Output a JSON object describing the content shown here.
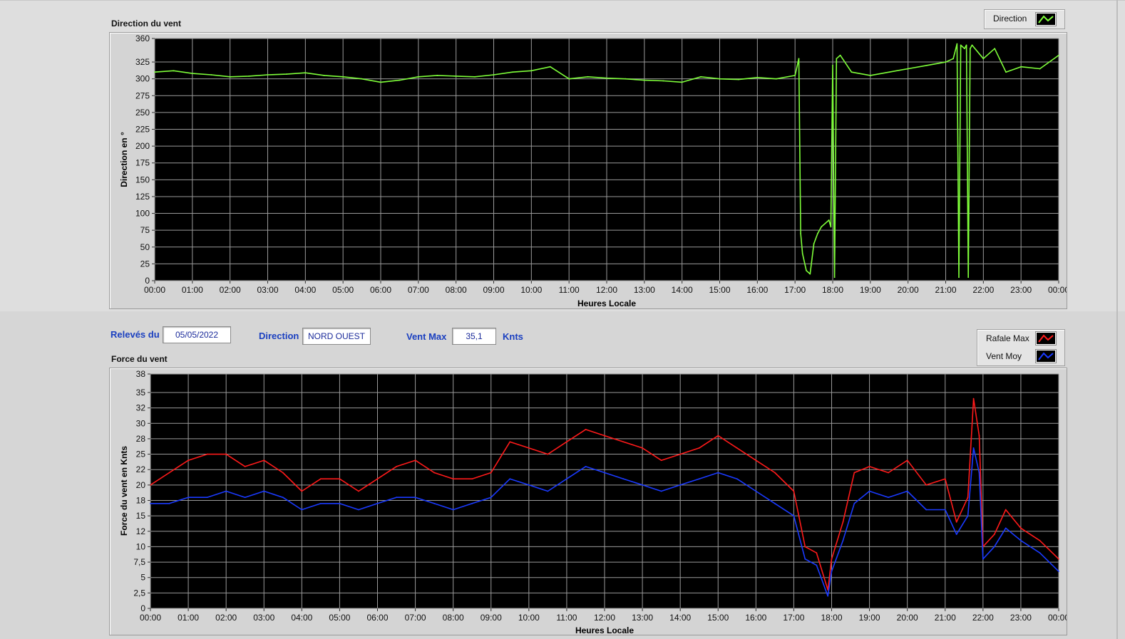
{
  "direction_chart": {
    "title": "Direction du vent",
    "legend": [
      {
        "label": "Direction",
        "color": "#7fff3a"
      }
    ]
  },
  "controls": {
    "releves_label": "Relevés du",
    "releves_value": "05/05/2022",
    "direction_label": "Direction",
    "direction_value": "NORD OUEST",
    "ventmax_label": "Vent Max",
    "ventmax_value": "35,1",
    "ventmax_unit": "Knts"
  },
  "force_chart": {
    "title": "Force du vent",
    "legend": [
      {
        "label": "Rafale Max",
        "color": "#ff1a1a"
      },
      {
        "label": "Vent Moy",
        "color": "#1a3aff"
      }
    ]
  },
  "chart_data": [
    {
      "type": "line",
      "title": "Direction du vent",
      "xlabel": "Heures Locale",
      "ylabel": "Direction en °",
      "xlim": [
        0,
        24
      ],
      "ylim": [
        0,
        360
      ],
      "x_ticks": [
        "00:00",
        "01:00",
        "02:00",
        "03:00",
        "04:00",
        "05:00",
        "06:00",
        "07:00",
        "08:00",
        "09:00",
        "10:00",
        "11:00",
        "12:00",
        "13:00",
        "14:00",
        "15:00",
        "16:00",
        "17:00",
        "18:00",
        "19:00",
        "20:00",
        "21:00",
        "22:00",
        "23:00",
        "00:00"
      ],
      "y_ticks": [
        0,
        25,
        50,
        75,
        100,
        125,
        150,
        175,
        200,
        225,
        250,
        275,
        300,
        325,
        360
      ],
      "y_tick_labels": [
        "0",
        "25",
        "50",
        "75",
        "100",
        "125",
        "150",
        "175",
        "200",
        "225",
        "250",
        "275",
        "300",
        "325",
        "360"
      ],
      "grid": true,
      "legend_position": "top-right",
      "series": [
        {
          "name": "Direction",
          "color": "#7fff3a",
          "x": [
            0,
            0.5,
            1,
            1.5,
            2,
            2.5,
            3,
            3.5,
            4,
            4.5,
            5,
            5.5,
            6,
            6.5,
            7,
            7.5,
            8,
            8.5,
            9,
            9.5,
            10,
            10.5,
            11,
            11.5,
            12,
            12.5,
            13,
            13.5,
            14,
            14.5,
            15,
            15.5,
            16,
            16.5,
            17,
            17.1,
            17.15,
            17.2,
            17.3,
            17.4,
            17.5,
            17.6,
            17.7,
            17.8,
            17.9,
            17.95,
            18,
            18.05,
            18.1,
            18.2,
            18.5,
            19,
            19.5,
            20,
            20.5,
            21,
            21.2,
            21.3,
            21.35,
            21.4,
            21.5,
            21.55,
            21.6,
            21.65,
            21.7,
            22,
            22.3,
            22.6,
            23,
            23.5,
            24
          ],
          "y": [
            310,
            312,
            308,
            306,
            303,
            304,
            306,
            307,
            309,
            305,
            303,
            300,
            295,
            298,
            303,
            305,
            304,
            303,
            306,
            310,
            312,
            318,
            300,
            303,
            301,
            300,
            298,
            297,
            295,
            303,
            300,
            299,
            302,
            300,
            305,
            330,
            70,
            40,
            15,
            10,
            55,
            70,
            80,
            85,
            90,
            80,
            320,
            5,
            330,
            335,
            310,
            305,
            310,
            315,
            320,
            325,
            330,
            352,
            5,
            350,
            345,
            350,
            5,
            345,
            350,
            330,
            345,
            310,
            318,
            315,
            335
          ]
        }
      ]
    },
    {
      "type": "line",
      "title": "Force du vent",
      "xlabel": "Heures Locale",
      "ylabel": "Force du vent en Knts",
      "xlim": [
        0,
        24
      ],
      "ylim": [
        0,
        38
      ],
      "x_ticks": [
        "00:00",
        "01:00",
        "02:00",
        "03:00",
        "04:00",
        "05:00",
        "06:00",
        "07:00",
        "08:00",
        "09:00",
        "10:00",
        "11:00",
        "12:00",
        "13:00",
        "14:00",
        "15:00",
        "16:00",
        "17:00",
        "18:00",
        "19:00",
        "20:00",
        "21:00",
        "22:00",
        "23:00",
        "00:00"
      ],
      "y_ticks": [
        0,
        2.5,
        5,
        7.5,
        10,
        12.5,
        15,
        17.5,
        20,
        22.5,
        25,
        27.5,
        30,
        32.5,
        35,
        38
      ],
      "y_tick_labels": [
        "0",
        "2,5",
        "5",
        "7,5",
        "10",
        "12",
        "15",
        "18",
        "20",
        "22",
        "25",
        "28",
        "30",
        "32",
        "35",
        "38"
      ],
      "grid": true,
      "legend_position": "top-right",
      "series": [
        {
          "name": "Rafale Max",
          "color": "#ff1a1a",
          "x": [
            0,
            0.5,
            1,
            1.5,
            2,
            2.5,
            3,
            3.5,
            4,
            4.5,
            5,
            5.5,
            6,
            6.5,
            7,
            7.5,
            8,
            8.5,
            9,
            9.5,
            10,
            10.5,
            11,
            11.5,
            12,
            12.5,
            13,
            13.5,
            14,
            14.5,
            15,
            15.5,
            16,
            16.5,
            17,
            17.3,
            17.6,
            17.9,
            18,
            18.3,
            18.6,
            19,
            19.5,
            20,
            20.5,
            21,
            21.3,
            21.6,
            21.75,
            21.9,
            22,
            22.3,
            22.6,
            23,
            23.5,
            24
          ],
          "y": [
            20,
            22,
            24,
            25,
            25,
            23,
            24,
            22,
            19,
            21,
            21,
            19,
            21,
            23,
            24,
            22,
            21,
            21,
            22,
            27,
            26,
            25,
            27,
            29,
            28,
            27,
            26,
            24,
            25,
            26,
            28,
            26,
            24,
            22,
            19,
            10,
            9,
            3,
            8,
            14,
            22,
            23,
            22,
            24,
            20,
            21,
            14,
            18,
            34,
            28,
            10,
            12,
            16,
            13,
            11,
            8
          ]
        },
        {
          "name": "Vent Moy",
          "color": "#1a3aff",
          "x": [
            0,
            0.5,
            1,
            1.5,
            2,
            2.5,
            3,
            3.5,
            4,
            4.5,
            5,
            5.5,
            6,
            6.5,
            7,
            7.5,
            8,
            8.5,
            9,
            9.5,
            10,
            10.5,
            11,
            11.5,
            12,
            12.5,
            13,
            13.5,
            14,
            14.5,
            15,
            15.5,
            16,
            16.5,
            17,
            17.3,
            17.6,
            17.9,
            18,
            18.3,
            18.6,
            19,
            19.5,
            20,
            20.5,
            21,
            21.3,
            21.6,
            21.75,
            21.9,
            22,
            22.3,
            22.6,
            23,
            23.5,
            24
          ],
          "y": [
            17,
            17,
            18,
            18,
            19,
            18,
            19,
            18,
            16,
            17,
            17,
            16,
            17,
            18,
            18,
            17,
            16,
            17,
            18,
            21,
            20,
            19,
            21,
            23,
            22,
            21,
            20,
            19,
            20,
            21,
            22,
            21,
            19,
            17,
            15,
            8,
            7,
            2,
            6,
            11,
            17,
            19,
            18,
            19,
            16,
            16,
            12,
            15,
            26,
            22,
            8,
            10,
            13,
            11,
            9,
            6
          ]
        }
      ]
    }
  ]
}
